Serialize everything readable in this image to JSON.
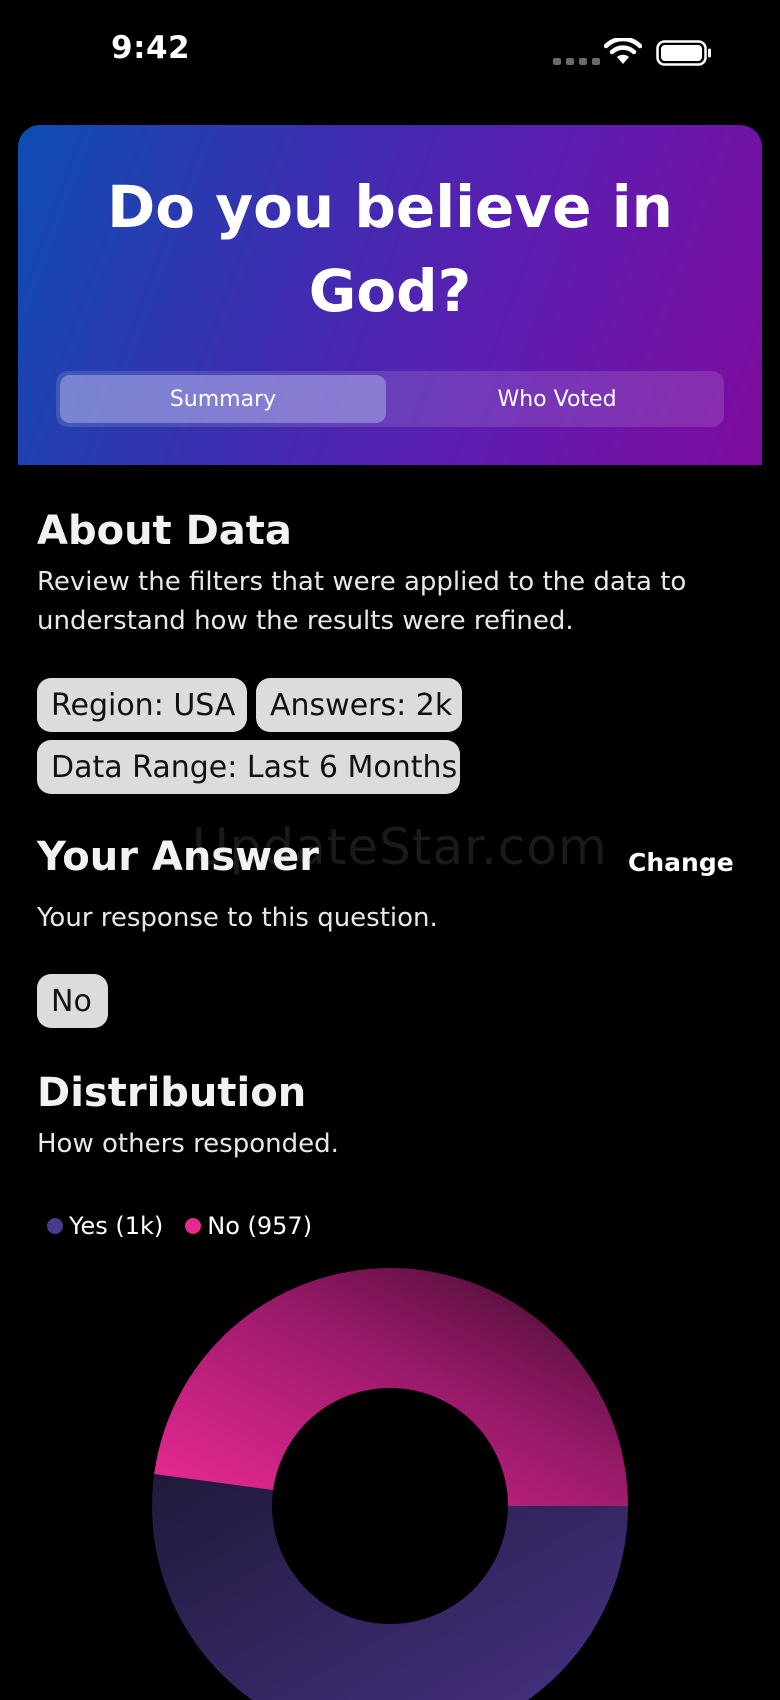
{
  "status_bar": {
    "time": "9:42"
  },
  "header": {
    "title": "Do you believe in God?",
    "tabs": [
      {
        "label": "Summary",
        "selected": true
      },
      {
        "label": "Who Voted",
        "selected": false
      }
    ]
  },
  "about": {
    "title": "About Data",
    "description": "Review the filters that were applied to the data to understand how the results were refined.",
    "filters": [
      "Region: USA",
      "Answers: 2k",
      "Data Range: Last 6 Months"
    ]
  },
  "your_answer": {
    "title": "Your Answer",
    "change_label": "Change",
    "description": "Your response to this question.",
    "answer": "No"
  },
  "watermark": "UpdateStar.com",
  "distribution": {
    "title": "Distribution",
    "description": "How others responded."
  },
  "chart_data": {
    "type": "pie",
    "series": [
      {
        "name": "Yes (1k)",
        "value": 1043,
        "color": "#4a3a8c"
      },
      {
        "name": "No (957)",
        "value": 957,
        "color": "#e62a90"
      }
    ]
  }
}
